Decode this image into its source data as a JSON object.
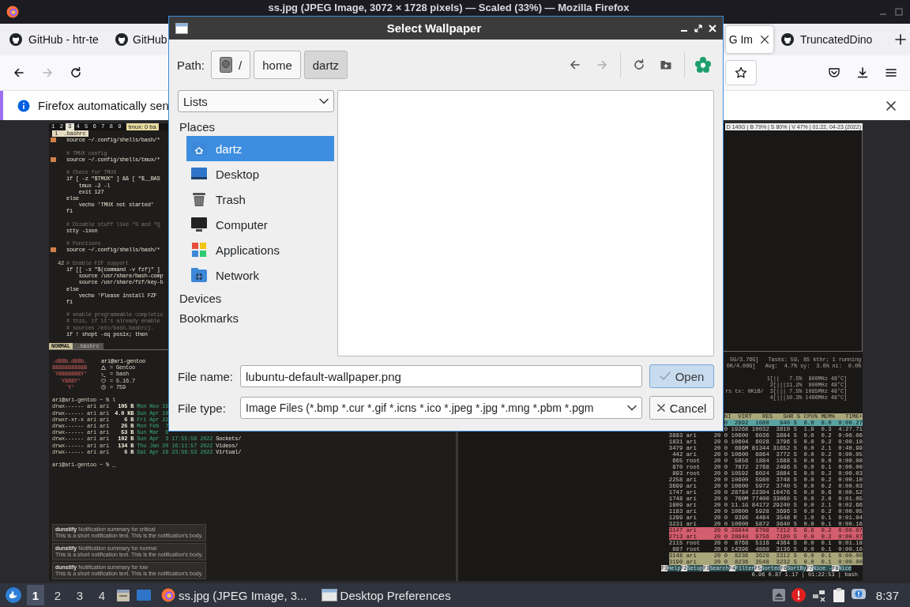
{
  "window": {
    "title": "ss.jpg (JPEG Image, 3072 × 1728 pixels) — Scaled (33%) — Mozilla Firefox"
  },
  "tabs": [
    {
      "label": "GitHub - htr-te",
      "icon": true,
      "selected": false
    },
    {
      "label": "GitHub",
      "icon": true,
      "selected": false
    },
    {
      "label": "G Im",
      "icon": false,
      "selected": true
    },
    {
      "label": "TruncatedDino",
      "icon": true,
      "selected": false
    }
  ],
  "toolbar": [
    {
      "kind": "back",
      "disabled": false
    },
    {
      "kind": "forward",
      "disabled": true
    },
    {
      "kind": "reload",
      "disabled": false
    }
  ],
  "notification": {
    "text": "Firefox automatically sen"
  },
  "screenshot": {
    "tmux": {
      "windows": [
        {
          "label": "1",
          "selected": false
        },
        {
          "label": "2",
          "selected": false
        },
        {
          "label": "3",
          "selected": true
        },
        {
          "label": "4",
          "selected": false
        },
        {
          "label": "5",
          "selected": false
        },
        {
          "label": "6",
          "selected": false
        },
        {
          "label": "7",
          "selected": false
        },
        {
          "label": "8",
          "selected": false
        },
        {
          "label": "9",
          "selected": false
        }
      ],
      "session": "tmux: 0 ba",
      "status": "D 140G | B 79% | S 80% | V 47% | 01:22, 04-23 (2022)"
    },
    "editor": {
      "tab": "1  .bashrc",
      "blocks": [
        [
          {
            "text": "source ~/.config/shells/bash/*",
            "kind": "code",
            "marked": true
          }
        ],
        [
          {
            "text": "# TMUX config",
            "kind": "comment",
            "marked": false
          },
          {
            "text": "source ~/.config/shells/tmux/*",
            "kind": "code",
            "marked": true
          }
        ],
        [
          {
            "text": "# Check for TMUX",
            "kind": "comment",
            "marked": false
          },
          {
            "text": "if [ -z \"$TMUX\" ] && [ \"$__BAS",
            "kind": "code",
            "marked": false
          },
          {
            "text": "    tmux -2 -l",
            "kind": "code",
            "marked": false
          },
          {
            "text": "    exit 127",
            "kind": "code",
            "marked": false
          },
          {
            "text": "else",
            "kind": "code",
            "marked": false
          },
          {
            "text": "    vecho 'TMUX not started'",
            "kind": "code",
            "marked": false
          },
          {
            "text": "fi",
            "kind": "code",
            "marked": false
          }
        ],
        [
          {
            "text": "# Disable stuff like ^S and ^Q",
            "kind": "comment",
            "marked": false
          },
          {
            "text": "stty -ixon",
            "kind": "code",
            "marked": false
          }
        ],
        [
          {
            "text": "# Functions",
            "kind": "comment",
            "marked": false
          },
          {
            "text": "source ~/.config/shells/bash/*",
            "kind": "code",
            "marked": true
          }
        ],
        [
          {
            "text": "# Enable FZF support",
            "kind": "comment",
            "marked": false,
            "number": "42"
          },
          {
            "text": "if [[ -x \"$(command -v fzf)\" ]",
            "kind": "code",
            "marked": false
          },
          {
            "text": "    source /usr/share/bash-comp",
            "kind": "code",
            "marked": false
          },
          {
            "text": "    source /usr/share/fzf/key-b",
            "kind": "code",
            "marked": false
          },
          {
            "text": "else",
            "kind": "code",
            "marked": false
          },
          {
            "text": "    vecho 'Please install FZF",
            "kind": "code",
            "marked": false
          },
          {
            "text": "fi",
            "kind": "code",
            "marked": false
          }
        ],
        [
          {
            "text": "# enable programmable completio",
            "kind": "comment",
            "marked": false
          },
          {
            "text": "# this, if it's already enable",
            "kind": "comment",
            "marked": false
          },
          {
            "text": "# sources /etc/bash.bashrc).",
            "kind": "comment",
            "marked": false
          },
          {
            "text": "if ! shopt -oq posix; then",
            "kind": "code",
            "marked": false
          }
        ]
      ],
      "mode": "NORMAL",
      "file": ".bashrc"
    },
    "neofetch": {
      "art": [
        ".d88b.d88b.",
        "88888888888",
        "`Y8888888Y'",
        "  `Y888Y'",
        "    `Y'"
      ],
      "user": "ari@ari-gentoo",
      "info": [
        "= Gentoo",
        "= bash",
        "= 5.16.7",
        "= 759"
      ]
    },
    "prompt": "ari@ari-gentoo ~ % l",
    "listing": [
      {
        "perms": "drwx------",
        "owner": "ari",
        "group": "ari",
        "size": "105 B",
        "date": "Mon Nov 15"
      },
      {
        "perms": "drwx------",
        "owner": "ari",
        "group": "ari",
        "size": "4.0 KB",
        "date": "Sun Apr 10"
      },
      {
        "perms": "drwxr-xr-x",
        "owner": "ari",
        "group": "ari",
        "size": "6 B",
        "date": "Fri Apr 22"
      },
      {
        "perms": "drwx------",
        "owner": "ari",
        "group": "ari",
        "size": "26 B",
        "date": "Mon Feb  7"
      },
      {
        "perms": "drwx------",
        "owner": "ari",
        "group": "ari",
        "size": "53 B",
        "date": "Sun Mar  6"
      },
      {
        "perms": "drwx------",
        "owner": "ari",
        "group": "ari",
        "size": "102 B",
        "date": "Sun Apr  3 17:55:56 2022",
        "name": "Sockets/"
      },
      {
        "perms": "drwx------",
        "owner": "ari",
        "group": "ari",
        "size": "134 B",
        "date": "Thu Jan 20 16:11:57 2022",
        "name": "Videos/"
      },
      {
        "perms": "drwx------",
        "owner": "ari",
        "group": "ari",
        "size": "6 B",
        "date": "Sat Apr 16 23:56:53 2022",
        "name": "Virtual/"
      }
    ],
    "prompt_2": "ari@ari-gentoo ~ % _",
    "notifications": [
      {
        "app": "dunstify",
        "summary": "Notification summary for critical",
        "body": "This is a short notification text. This is the notification's body."
      },
      {
        "app": "dunstify",
        "summary": "Notification summary for normal",
        "body": "This is a short notification text. This is the notification's body."
      },
      {
        "app": "dunstify",
        "summary": "Notification summary for low",
        "body": "This is a short notification text. This is the notification's body."
      }
    ],
    "htop": {
      "meters": [
        "5G/3.76G]   Tasks: 59, 85 kthr; 1 running",
        "0K/4.00G]   Avg:  4.7% sy:  3.0% ni:  0.0%"
      ],
      "cpus": [
        "1[||   7.5%  800MHz 48°C]",
        "2[|||11.2%  800MHz 48°C]",
        "rs tx: 0KiB/  3[||| 7.5% 1085MHz 48°C]",
        "4[|||10.3% 1496MHz 48°C]"
      ],
      "rows": [
        {
          "text": "NI  VIRT   RES   SHR S CPU% MEM%   TIME+",
          "kind": "header"
        },
        {
          "text": "0  2892  1080   940 S  0.0  0.0  0:00.27",
          "kind": "selected"
        },
        {
          "text": "0 19268 10032  3810 S  1.9  0.3  4:27.71",
          "kind": "normal"
        },
        {
          "text": "3883 ari     20 0 10600  6036  3884 S  0.0  0.2  0:00.06",
          "kind": "normal"
        },
        {
          "text": "1831 ari     20 0 10604  6028  3796 S  0.0  0.2  0:00.10",
          "kind": "normal"
        },
        {
          "text": "3479 ari     20 0  666M 81344 31652 S  0.0  2.1  0:40.99",
          "kind": "normal"
        },
        {
          "text": " 442 ari     20 0 10600  6864  3772 S  0.0  0.2  0:00.05",
          "kind": "normal"
        },
        {
          "text": " 665 root    20 0  5856  1884  1688 S  0.0  0.0  0:00.00",
          "kind": "normal"
        },
        {
          "text": " 870 root    20 0  7872  2768  2496 S  0.0  0.1  0:00.00",
          "kind": "normal"
        },
        {
          "text": " 893 root    20 0 10592  6024  3884 S  0.0  0.2  0:00.03",
          "kind": "normal"
        },
        {
          "text": "2258 ari     20 0 10600  5980  3748 S  0.0  0.2  0:00.10",
          "kind": "normal"
        },
        {
          "text": "3699 ari     20 0 10600  5972  3740 S  0.0  0.2  0:00.03",
          "kind": "normal"
        },
        {
          "text": "1747 ari     20 0 28784 22304 10476 S  0.0  0.6  0:00.52",
          "kind": "normal"
        },
        {
          "text": "1748 ari     20 0  760M 77400 33060 S  0.0  2.0  0:01.05",
          "kind": "normal"
        },
        {
          "text": "1809 ari     20 0 11.1G 84172 29240 S  0.0  2.1  0:02.66",
          "kind": "normal"
        },
        {
          "text": "1183 ari     20 0 10600  5928  3696 S  0.0  0.2  0:00.05",
          "kind": "normal"
        },
        {
          "text": "1299 ari     20 0  9396  4464  3548 R  1.0  0.1  0:01.04",
          "kind": "normal"
        },
        {
          "text": "3231 ari     20 0 10600  5872  3640 S  0.0  0.1  0:00.16",
          "kind": "normal"
        },
        {
          "text": "3147 ari     20 0 28844  9708  7212 S  6.6  0.2  0:00.07",
          "kind": "tagged"
        },
        {
          "text": "2713 ari     20 0 28844  9756  7180 S  0.0  0.2  0:00.07",
          "kind": "tagged"
        },
        {
          "text": "2115 root    20 0  8768  5116  4364 S  0.0  0.1  0:01.18",
          "kind": "normal"
        },
        {
          "text": " 887 root    20 0 14396  4888  3136 S  0.0  0.1  0:00.16",
          "kind": "normal"
        },
        {
          "text": "3148 ari     20 0  8236  3628  3312 S  0.0  0.1  0:00.00",
          "kind": "marked"
        },
        {
          "text": "3190 ari     20 0  8236  3548  3232 S  0.0  0.1  0:00.00",
          "kind": "marked"
        }
      ],
      "keys": [
        {
          "key": "F1",
          "label": "Help"
        },
        {
          "key": "F2",
          "label": "Setup"
        },
        {
          "key": "F3",
          "label": "Search"
        },
        {
          "key": "F4",
          "label": "Filter"
        },
        {
          "key": "F5",
          "label": "Sorted"
        },
        {
          "key": "F6",
          "label": "SortBy"
        },
        {
          "key": "F7",
          "label": "Nice -"
        },
        {
          "key": "F8",
          "label": "Nice"
        }
      ],
      "load": "0.96 0.87 1.17 | 01:22:53 | bash"
    }
  },
  "dialog": {
    "title": "Select Wallpaper",
    "path_label": "Path:",
    "path": [
      {
        "label": "/",
        "kind": "root",
        "selected": false
      },
      {
        "label": "home",
        "kind": "folder",
        "selected": false
      },
      {
        "label": "dartz",
        "kind": "folder",
        "selected": true
      }
    ],
    "tools": [
      {
        "kind": "back",
        "disabled": false
      },
      {
        "kind": "forward",
        "disabled": true
      },
      {
        "kind": "reload",
        "disabled": false
      },
      {
        "kind": "new-folder",
        "disabled": false
      },
      {
        "kind": "app",
        "disabled": false
      }
    ],
    "view_mode": "Lists",
    "places_heading": "Places",
    "places": [
      {
        "label": "dartz",
        "kind": "home",
        "selected": true
      },
      {
        "label": "Desktop",
        "kind": "desktop",
        "selected": false
      },
      {
        "label": "Trash",
        "kind": "trash",
        "selected": false
      },
      {
        "label": "Computer",
        "kind": "computer",
        "selected": false
      },
      {
        "label": "Applications",
        "kind": "applications",
        "selected": false
      },
      {
        "label": "Network",
        "kind": "network",
        "selected": false
      }
    ],
    "sections": [
      "Devices",
      "Bookmarks"
    ],
    "file_name": {
      "label": "File name:",
      "value": "lubuntu-default-wallpaper.png"
    },
    "file_type": {
      "label": "File type:",
      "value": "Image Files (*.bmp *.cur *.gif *.icns *.ico *.jpeg *.jpg *.mng *.pbm *.pgm"
    },
    "buttons": [
      {
        "label": "Open",
        "kind": "open",
        "default": true
      },
      {
        "label": "Cancel",
        "kind": "cancel",
        "default": false
      }
    ]
  },
  "taskbar": {
    "workspaces": [
      {
        "label": "1",
        "selected": true
      },
      {
        "label": "2",
        "selected": false
      },
      {
        "label": "3",
        "selected": false
      },
      {
        "label": "4",
        "selected": false
      }
    ],
    "tasks": [
      {
        "label": "ss.jpg (JPEG Image, 3...",
        "kind": "browser"
      },
      {
        "label": "Desktop Preferences",
        "kind": "window"
      }
    ],
    "clock": "8:37"
  }
}
